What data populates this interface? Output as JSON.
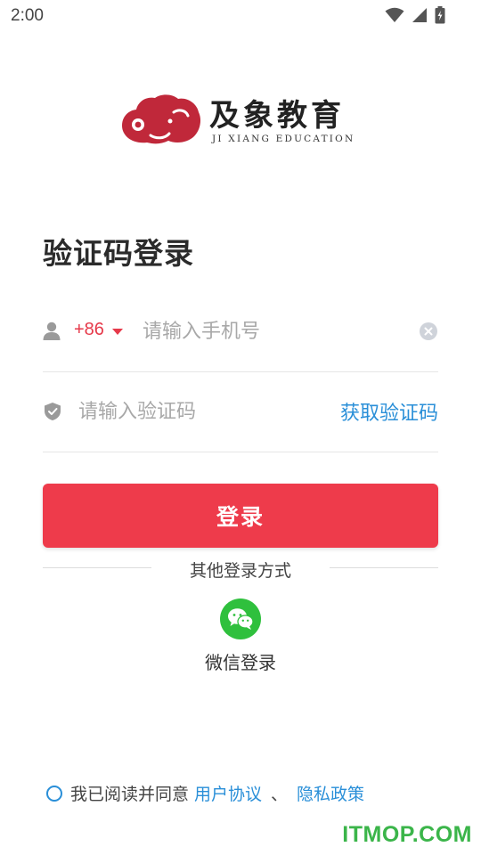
{
  "status_bar": {
    "time": "2:00"
  },
  "logo": {
    "title": "及象教育",
    "subtitle": "JI XIANG EDUCATION",
    "brand_color": "#c0283a"
  },
  "page": {
    "title": "验证码登录"
  },
  "phone_row": {
    "country_code": "+86",
    "placeholder": "请输入手机号",
    "value": ""
  },
  "code_row": {
    "placeholder": "请输入验证码",
    "value": "",
    "get_code_label": "获取验证码"
  },
  "login_button": {
    "label": "登录",
    "color": "#ee3b4b"
  },
  "other_login": {
    "label": "其他登录方式",
    "wechat_label": "微信登录",
    "wechat_color": "#2fc03d"
  },
  "agreement": {
    "prefix": "我已阅读并同意",
    "user_agreement": "用户协议",
    "separator": "、",
    "privacy_policy": "隐私政策"
  },
  "watermark": {
    "text": "ITMOP.COM"
  },
  "icons": {
    "user": "user-icon",
    "clear": "clear-icon",
    "shield": "shield-icon",
    "wechat": "wechat-icon",
    "wifi": "wifi-icon",
    "signal": "signal-icon",
    "battery": "battery-icon"
  },
  "colors": {
    "accent_red": "#e6394a",
    "link_blue": "#2a8fd8"
  }
}
